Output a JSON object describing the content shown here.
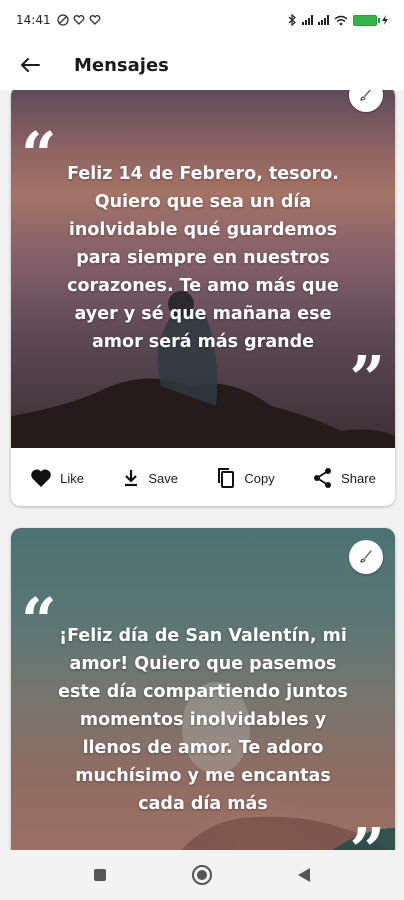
{
  "status_bar": {
    "time": "14:41",
    "icons_left": [
      "do-not-disturb-icon",
      "heart-signal-icon",
      "heart-signal-icon"
    ],
    "icons_right": [
      "bluetooth-icon",
      "signal-icon",
      "signal-icon",
      "wifi-icon",
      "battery-icon",
      "charging-icon"
    ],
    "battery_color": "#38b24a"
  },
  "app_bar": {
    "title": "Mensajes",
    "back_icon": "arrow-left-icon"
  },
  "cards": [
    {
      "text": "Feliz 14 de Febrero, tesoro. Quiero que sea un día inolvidable qué guardemos para siempre en nuestros corazones. Te amo más que ayer y sé que mañana ese amor será más grande",
      "open_quote": "“",
      "close_quote": "”",
      "actions": {
        "like": "Like",
        "save": "Save",
        "copy": "Copy",
        "share": "Share"
      }
    },
    {
      "text": "¡Feliz día de San Valentín, mi amor! Quiero que pasemos este día compartiendo juntos momentos inolvidables y llenos de amor. Te adoro muchísimo y me encantas cada día más",
      "open_quote": "“",
      "close_quote": "”"
    }
  ],
  "colors": {
    "text_primary": "#1b1b1b",
    "quote_text": "#ffffff",
    "background": "#f2f2f2"
  },
  "nav": [
    "recents-square-icon",
    "home-circle-icon",
    "back-triangle-icon"
  ]
}
